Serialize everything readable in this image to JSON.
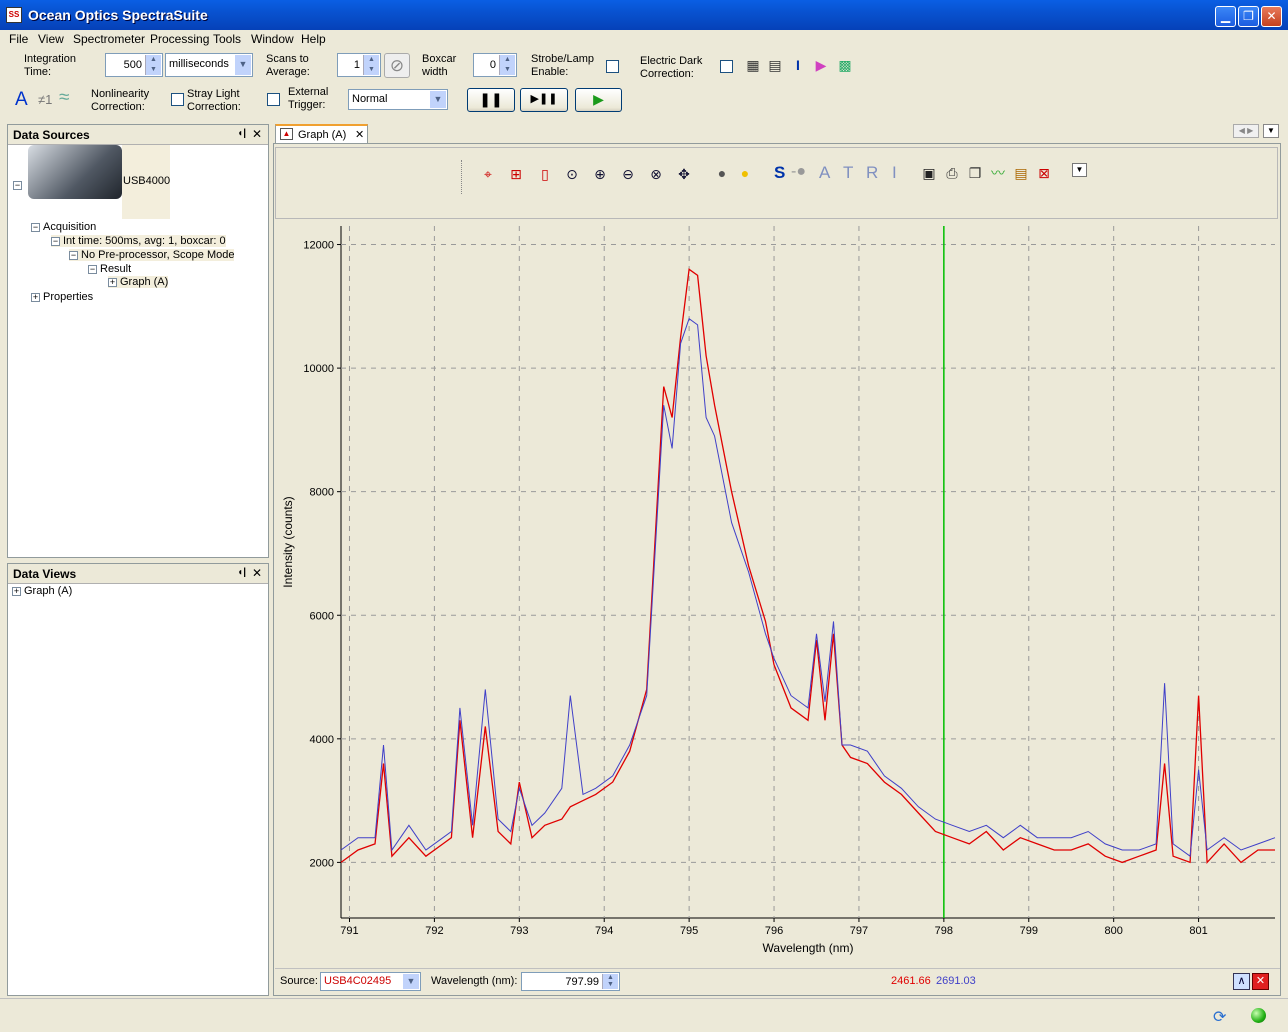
{
  "window": {
    "title": "Ocean Optics SpectraSuite"
  },
  "menu": [
    "File",
    "View",
    "Spectrometer",
    "Processing",
    "Tools",
    "Window",
    "Help"
  ],
  "toolbar": {
    "integration_label1": "Integration",
    "integration_label2": "Time:",
    "integration_value": "500",
    "integration_unit": "milliseconds",
    "scans_label1": "Scans to",
    "scans_label2": "Average:",
    "scans_value": "1",
    "boxcar_label1": "Boxcar",
    "boxcar_label2": "width",
    "boxcar_value": "0",
    "strobe_label1": "Strobe/Lamp",
    "strobe_label2": "Enable:",
    "dark_label1": "Electric Dark",
    "dark_label2": "Correction:",
    "nonlin_label1": "Nonlinearity",
    "nonlin_label2": "Correction:",
    "stray_label1": "Stray Light",
    "stray_label2": "Correction:",
    "trigger_label1": "External",
    "trigger_label2": "Trigger:",
    "trigger_value": "Normal",
    "glyph_a": "A",
    "glyph_ne1": "≠1"
  },
  "data_sources": {
    "title": "Data Sources",
    "device": "USB4000",
    "acquisition": "Acquisition",
    "int_time": "Int time: 500ms, avg: 1, boxcar: 0",
    "preprocessor": "No Pre-processor, Scope Mode",
    "result": "Result",
    "graph": "Graph (A)",
    "properties": "Properties"
  },
  "data_views": {
    "title": "Data Views",
    "graph": "Graph (A)"
  },
  "graph_tab": {
    "label": "Graph (A)"
  },
  "graph_toolbar": {
    "letters": [
      "S",
      "A",
      "T",
      "R",
      "I"
    ]
  },
  "footer": {
    "source_label": "Source:",
    "source_value": "USB4C02495",
    "wavelength_label": "Wavelength (nm):",
    "wavelength_value": "797.99",
    "readout_red": "2461.66",
    "readout_blue": "2691.03"
  },
  "colors": {
    "series_red": "#e00000",
    "series_blue": "#4040c8",
    "cursor": "#00c000"
  },
  "chart_data": {
    "type": "line",
    "xlabel": "Wavelength (nm)",
    "ylabel": "Intensity (counts)",
    "xlim": [
      790.9,
      801.9
    ],
    "ylim": [
      1100,
      12300
    ],
    "xticks": [
      791,
      792,
      793,
      794,
      795,
      796,
      797,
      798,
      799,
      800,
      801
    ],
    "yticks": [
      2000,
      4000,
      6000,
      8000,
      10000,
      12000
    ],
    "grid": true,
    "cursor_x": 798.0,
    "x": [
      790.9,
      791.1,
      791.3,
      791.4,
      791.5,
      791.7,
      791.9,
      792.1,
      792.2,
      792.3,
      792.45,
      792.6,
      792.75,
      792.9,
      793.0,
      793.15,
      793.3,
      793.5,
      793.6,
      793.75,
      793.9,
      794.1,
      794.3,
      794.5,
      794.7,
      794.8,
      794.9,
      795.0,
      795.1,
      795.2,
      795.3,
      795.5,
      795.7,
      795.9,
      796.0,
      796.2,
      796.4,
      796.5,
      796.6,
      796.7,
      796.8,
      796.9,
      797.1,
      797.3,
      797.5,
      797.7,
      797.9,
      798.1,
      798.3,
      798.5,
      798.7,
      798.9,
      799.1,
      799.3,
      799.5,
      799.7,
      799.9,
      800.1,
      800.3,
      800.5,
      800.6,
      800.7,
      800.9,
      801.0,
      801.1,
      801.3,
      801.5,
      801.7,
      801.9
    ],
    "series": [
      {
        "values": [
          2000,
          2200,
          2300,
          3600,
          2100,
          2400,
          2100,
          2300,
          2400,
          4300,
          2400,
          4200,
          2500,
          2300,
          3300,
          2400,
          2600,
          2700,
          2900,
          3000,
          3100,
          3300,
          3800,
          4800,
          9700,
          9200,
          10500,
          11600,
          11500,
          10200,
          9400,
          8000,
          6800,
          5900,
          5200,
          4500,
          4300,
          5600,
          4300,
          5700,
          3900,
          3700,
          3600,
          3300,
          3100,
          2800,
          2500,
          2400,
          2300,
          2500,
          2200,
          2400,
          2300,
          2200,
          2200,
          2300,
          2100,
          2000,
          2100,
          2200,
          3600,
          2100,
          2000,
          4700,
          2000,
          2300,
          2000,
          2200,
          2200
        ]
      },
      {
        "values": [
          2200,
          2400,
          2400,
          3900,
          2200,
          2600,
          2200,
          2400,
          2500,
          4500,
          2600,
          4800,
          2700,
          2500,
          3200,
          2600,
          2800,
          3200,
          4700,
          3100,
          3200,
          3400,
          3900,
          4700,
          9400,
          8700,
          10400,
          10800,
          10700,
          9200,
          8900,
          7500,
          6700,
          5700,
          5300,
          4700,
          4500,
          5700,
          4600,
          5900,
          3900,
          3900,
          3800,
          3400,
          3200,
          2900,
          2700,
          2600,
          2500,
          2600,
          2400,
          2600,
          2400,
          2400,
          2400,
          2500,
          2300,
          2200,
          2200,
          2300,
          4900,
          2300,
          2100,
          3500,
          2200,
          2400,
          2200,
          2300,
          2400
        ]
      }
    ]
  }
}
